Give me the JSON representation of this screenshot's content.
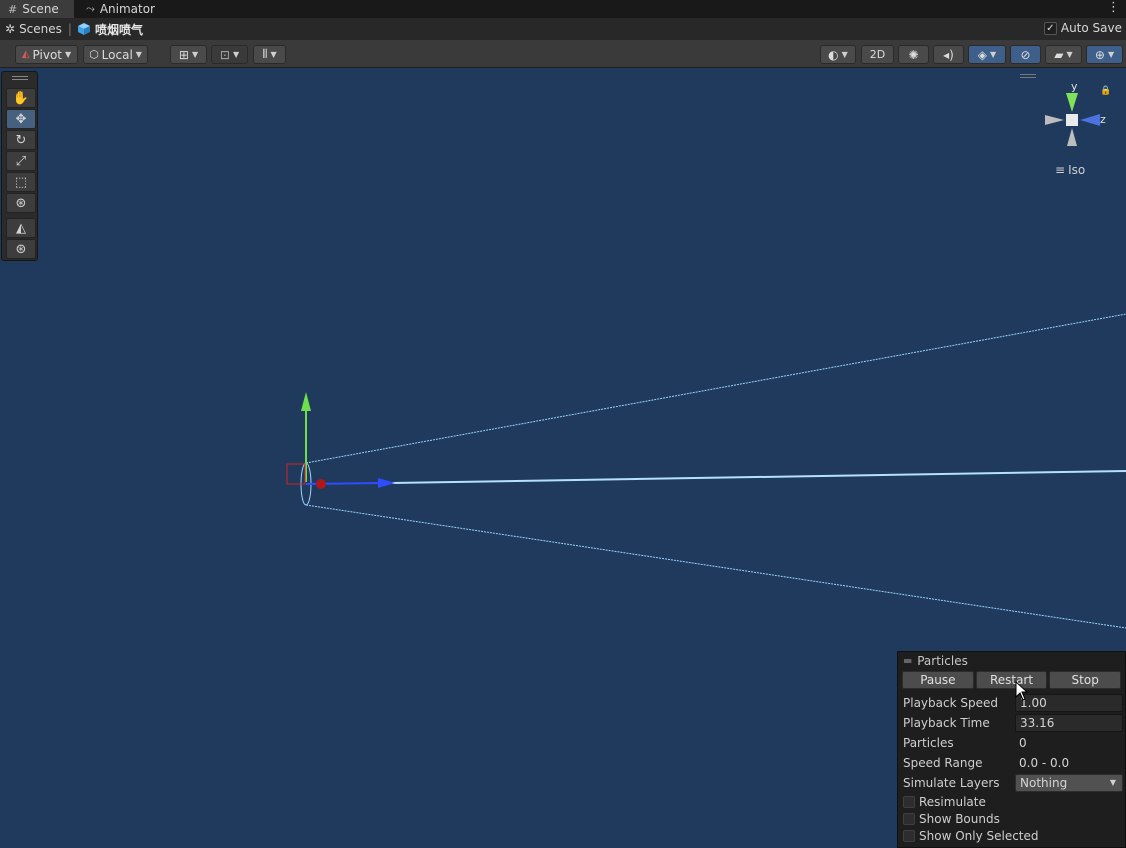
{
  "tabs": [
    {
      "label": "Scene",
      "icon": "grid-icon"
    },
    {
      "label": "Animator",
      "icon": "animator-icon"
    }
  ],
  "breadcrumb": {
    "root": "Scenes",
    "object": "喷烟喷气"
  },
  "auto_save": {
    "label": "Auto Save",
    "checked": true
  },
  "toolbar": {
    "pivot_label": "Pivot",
    "local_label": "Local",
    "mode_2d_label": "2D"
  },
  "gizmo": {
    "y_label": "y",
    "z_label": "z",
    "projection_label": "Iso"
  },
  "particles": {
    "title": "Particles",
    "buttons": {
      "pause": "Pause",
      "restart": "Restart",
      "stop": "Stop"
    },
    "playback_speed": {
      "label": "Playback Speed",
      "value": "1.00"
    },
    "playback_time": {
      "label": "Playback Time",
      "value": "33.16"
    },
    "particles_count": {
      "label": "Particles",
      "value": "0"
    },
    "speed_range": {
      "label": "Speed Range",
      "value": "0.0 - 0.0"
    },
    "simulate_layers": {
      "label": "Simulate Layers",
      "value": "Nothing"
    },
    "resimulate": {
      "label": "Resimulate",
      "checked": false
    },
    "show_bounds": {
      "label": "Show Bounds",
      "checked": false
    },
    "show_only_selected": {
      "label": "Show Only Selected",
      "checked": false
    }
  },
  "colors": {
    "scene_background": "#1f3a5c",
    "cone_lines": "#9fd3ff",
    "y_axis": "#6ee04c",
    "z_axis": "#2f4cff",
    "x_axis": "#d02424"
  }
}
